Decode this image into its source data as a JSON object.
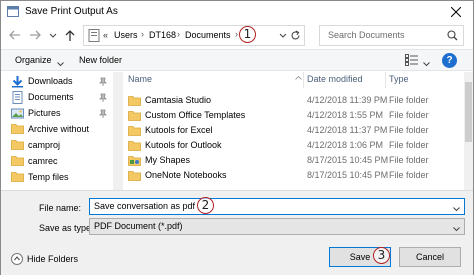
{
  "window": {
    "title": "Save Print Output As"
  },
  "address": {
    "overflow_chevron": "«",
    "crumbs": [
      "Users",
      "DT168",
      "Documents"
    ],
    "separator": "›"
  },
  "search": {
    "placeholder": "Search Documents"
  },
  "toolbar": {
    "organize_label": "Organize",
    "newfolder_label": "New folder",
    "help_label": "?"
  },
  "navpane": {
    "items": [
      {
        "label": "Downloads",
        "icon": "download-icon",
        "pinned": true
      },
      {
        "label": "Documents",
        "icon": "documents-icon",
        "pinned": true
      },
      {
        "label": "Pictures",
        "icon": "pictures-icon",
        "pinned": true
      },
      {
        "label": "Archive without",
        "icon": "folder-icon",
        "pinned": false
      },
      {
        "label": "camproj",
        "icon": "folder-icon",
        "pinned": false
      },
      {
        "label": "camrec",
        "icon": "folder-icon",
        "pinned": false
      },
      {
        "label": "Temp files",
        "icon": "folder-icon",
        "pinned": false
      }
    ]
  },
  "filelist": {
    "columns": {
      "name": "Name",
      "date": "Date modified",
      "type": "Type"
    },
    "rows": [
      {
        "name": "Camtasia Studio",
        "date": "4/12/2018 11:39 PM",
        "type": "File folder",
        "icon": "folder-icon"
      },
      {
        "name": "Custom Office Templates",
        "date": "4/12/2018 1:55 PM",
        "type": "File folder",
        "icon": "folder-icon"
      },
      {
        "name": "Kutools for Excel",
        "date": "4/12/2018 11:37 PM",
        "type": "File folder",
        "icon": "folder-icon"
      },
      {
        "name": "Kutools for Outlook",
        "date": "4/12/2018 1:06 PM",
        "type": "File folder",
        "icon": "folder-icon"
      },
      {
        "name": "My Shapes",
        "date": "8/17/2015 10:45 PM",
        "type": "File folder",
        "icon": "shapes-folder-icon"
      },
      {
        "name": "OneNote Notebooks",
        "date": "8/17/2015 10:45 PM",
        "type": "File folder",
        "icon": "folder-icon"
      }
    ]
  },
  "form": {
    "filename_label": "File name:",
    "filename_value": "Save conversation as pdf",
    "savetype_label": "Save as type:",
    "savetype_value": "PDF Document (*.pdf)"
  },
  "footer": {
    "hide_folders_label": "Hide Folders",
    "save_label": "Save",
    "cancel_label": "Cancel"
  },
  "steps": [
    "1",
    "2",
    "3"
  ],
  "colors": {
    "accent": "#0078d7",
    "folder": "#f4c862",
    "step_ring": "#b22222",
    "help": "#1e6fd0"
  }
}
